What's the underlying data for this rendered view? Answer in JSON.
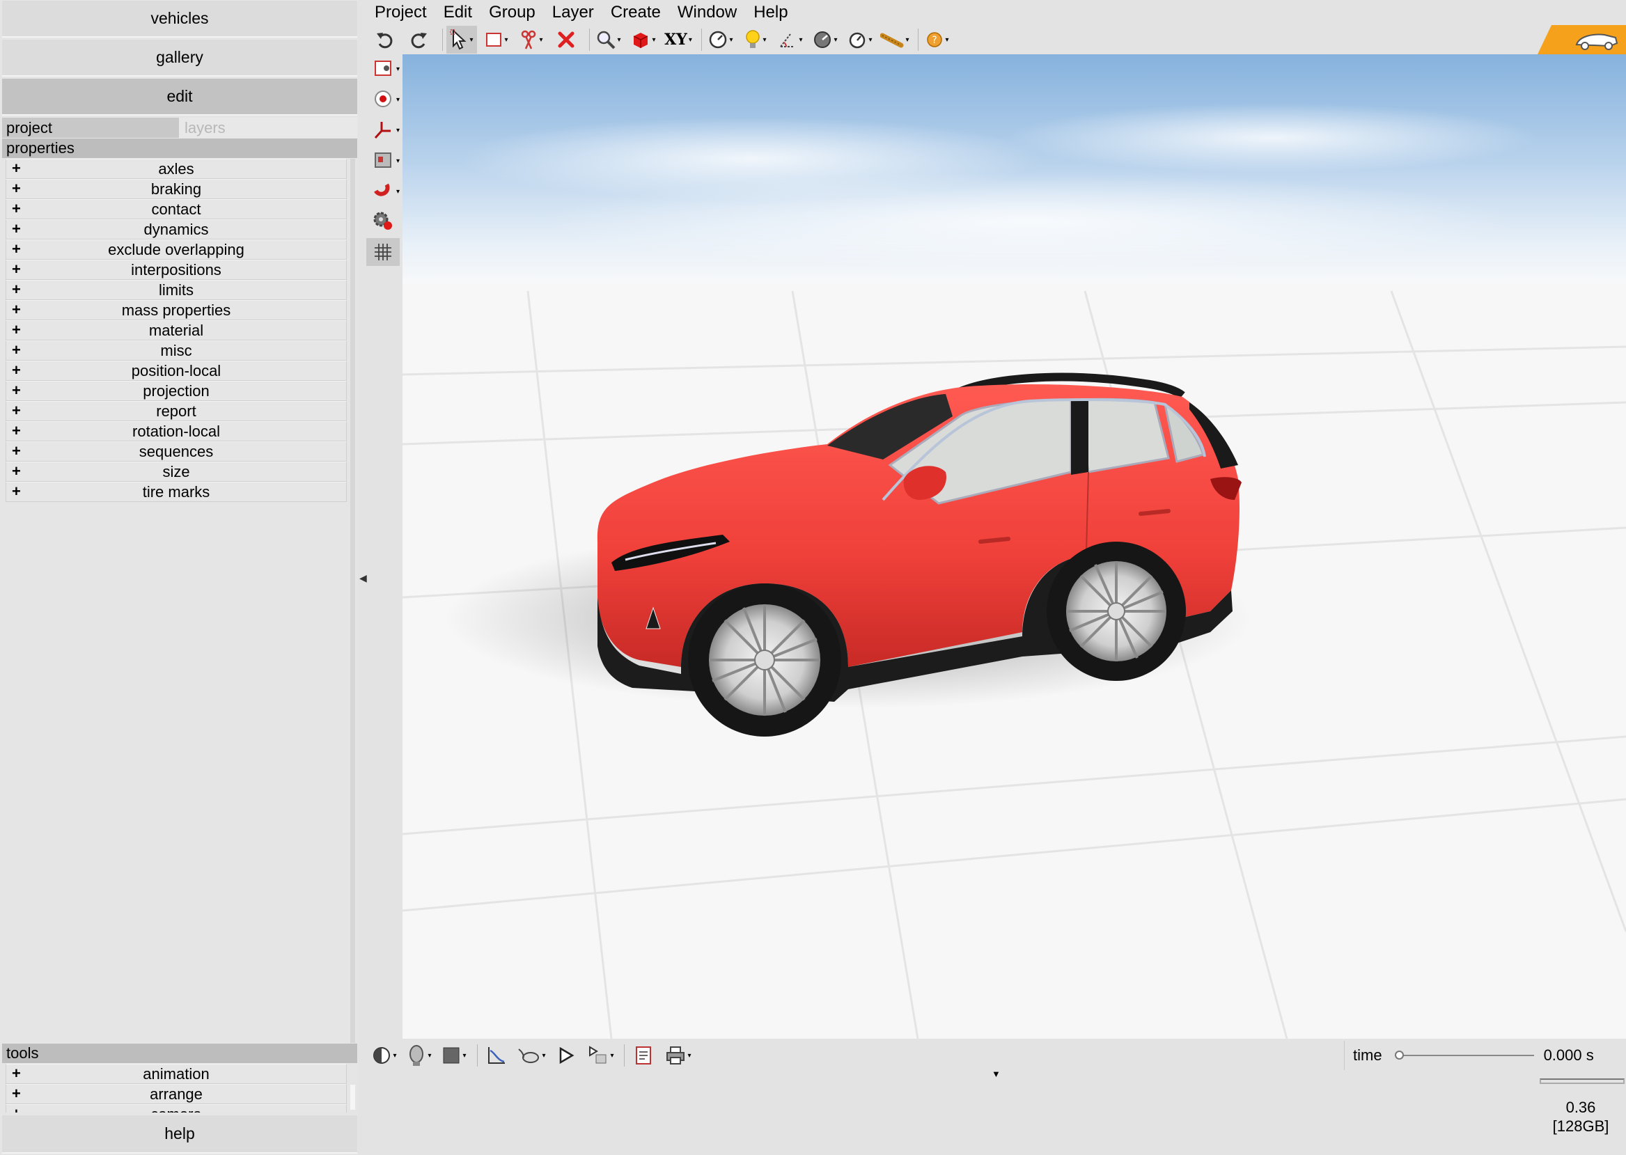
{
  "left": {
    "buttons": {
      "vehicles": "vehicles",
      "gallery": "gallery",
      "edit": "edit",
      "help": "help"
    },
    "tabs": {
      "project": "project",
      "layers": "layers"
    },
    "properties_label": "properties",
    "properties": [
      "axles",
      "braking",
      "contact",
      "dynamics",
      "exclude overlapping",
      "interpositions",
      "limits",
      "mass properties",
      "material",
      "misc",
      "position-local",
      "projection",
      "report",
      "rotation-local",
      "sequences",
      "size",
      "tire marks"
    ],
    "tools_label": "tools",
    "tools": [
      "animation",
      "arrange",
      "camera"
    ],
    "expand_symbol": "+"
  },
  "menu": [
    "Project",
    "Edit",
    "Group",
    "Layer",
    "Create",
    "Window",
    "Help"
  ],
  "toolbar": {
    "xy_label": "XY",
    "icons": [
      "undo-icon",
      "redo-icon",
      "select-arrow-icon",
      "rectangle-select-icon",
      "scissors-icon",
      "delete-x-icon",
      "zoom-icon",
      "red-cube-icon",
      "xy-plane-icon",
      "gauge-icon",
      "lightbulb-icon",
      "measure-angle-icon",
      "dial-icon",
      "stopwatch-icon",
      "tape-measure-icon",
      "help-circle-icon"
    ]
  },
  "status": {
    "time_label": "time",
    "time_value": "0.000 s",
    "time_position": 0,
    "stat_value": "0.36",
    "memory": "[128GB]"
  },
  "colors": {
    "accent_orange": "#f5a11b",
    "car_red": "#f0463f",
    "sky_blue": "#9bbfe0",
    "panel_bg": "#e5e5e5"
  }
}
